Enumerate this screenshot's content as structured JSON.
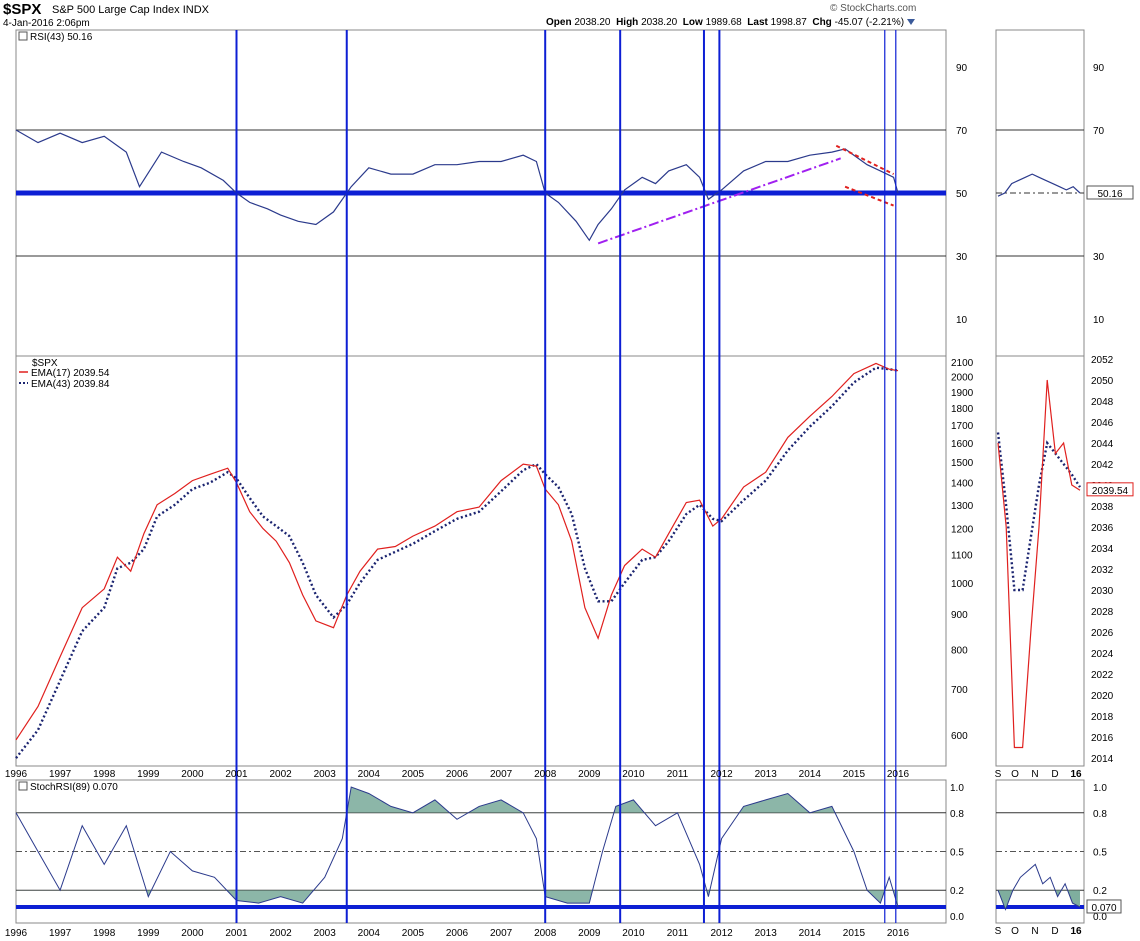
{
  "header": {
    "symbol": "$SPX",
    "name": "S&P 500 Large Cap Index",
    "exchange": "INDX",
    "date": "4-Jan-2016 2:06pm",
    "credit": "© StockCharts.com",
    "open_label": "Open",
    "open": "2038.20",
    "high_label": "High",
    "high": "2038.20",
    "low_label": "Low",
    "low": "1989.68",
    "last_label": "Last",
    "last": "1998.87",
    "chg_label": "Chg",
    "chg": "-45.07 (-2.21%)"
  },
  "colors": {
    "price_line": "#2b3a8c",
    "ema17": "#e0201e",
    "ema43": "#1b2470",
    "vertical_lines": "#0d1fd4",
    "trend_purple": "#a020f0",
    "trend_red": "#e0201e",
    "stoch_fill": "#7fae9e"
  },
  "chart_data": [
    {
      "type": "line",
      "title": "RSI(43) 50.16",
      "legend": "RSI(43) 50.16",
      "yticks": [
        "90",
        "70",
        "50",
        "30",
        "10"
      ],
      "ylim": [
        0,
        100
      ],
      "x": [
        1996.0,
        1996.5,
        1997.0,
        1997.5,
        1998.0,
        1998.5,
        1998.8,
        1999.3,
        1999.8,
        2000.2,
        2000.7,
        2001.0,
        2001.3,
        2001.7,
        2002.0,
        2002.4,
        2002.8,
        2003.2,
        2003.6,
        2004.0,
        2004.5,
        2005.0,
        2005.5,
        2006.0,
        2006.5,
        2007.0,
        2007.5,
        2007.8,
        2008.0,
        2008.3,
        2008.7,
        2009.0,
        2009.2,
        2009.5,
        2009.8,
        2010.2,
        2010.5,
        2010.8,
        2011.2,
        2011.5,
        2011.7,
        2012.0,
        2012.5,
        2013.0,
        2013.5,
        2014.0,
        2014.5,
        2014.8,
        2015.0,
        2015.3,
        2015.6,
        2015.9,
        2016.0
      ],
      "values": [
        70,
        66,
        69,
        66,
        68,
        63,
        52,
        63,
        60,
        58,
        54,
        50,
        47,
        45,
        43,
        41,
        40,
        44,
        52,
        58,
        56,
        56,
        59,
        59,
        60,
        60,
        62,
        60,
        50,
        47,
        41,
        35,
        40,
        45,
        51,
        55,
        53,
        57,
        59,
        55,
        48,
        51,
        57,
        60,
        60,
        62,
        63,
        64,
        62,
        59,
        57,
        55,
        50
      ],
      "reference_lines": [
        70,
        50,
        30
      ],
      "trendlines": [
        {
          "color": "purple",
          "from": [
            2009.2,
            34
          ],
          "to": [
            2014.7,
            61
          ]
        },
        {
          "color": "red",
          "from": [
            2014.6,
            65
          ],
          "to": [
            2015.9,
            56
          ]
        },
        {
          "color": "red",
          "from": [
            2014.8,
            52
          ],
          "to": [
            2015.9,
            46
          ]
        }
      ],
      "inset": {
        "value_label": "50.16",
        "values": [
          49,
          50,
          53,
          54,
          55,
          56,
          55,
          54,
          53,
          52,
          51,
          52,
          50
        ]
      }
    },
    {
      "type": "line",
      "title": "$SPX",
      "legend": [
        "$SPX",
        "EMA(17) 2039.54",
        "EMA(43) 2039.84"
      ],
      "yscale": "log",
      "yticks": [
        "2100",
        "2000",
        "1900",
        "1800",
        "1700",
        "1600",
        "1500",
        "1400",
        "1300",
        "1200",
        "1100",
        "1000",
        "900",
        "800",
        "700",
        "600"
      ],
      "ylim": [
        540,
        2150
      ],
      "x": [
        1996.0,
        1996.5,
        1997.0,
        1997.5,
        1998.0,
        1998.3,
        1998.6,
        1998.9,
        1999.2,
        1999.6,
        2000.0,
        2000.4,
        2000.8,
        2001.0,
        2001.3,
        2001.6,
        2001.9,
        2002.2,
        2002.5,
        2002.8,
        2003.2,
        2003.5,
        2003.8,
        2004.2,
        2004.6,
        2005.0,
        2005.5,
        2006.0,
        2006.5,
        2007.0,
        2007.5,
        2007.8,
        2008.0,
        2008.3,
        2008.6,
        2008.9,
        2009.2,
        2009.5,
        2009.8,
        2010.2,
        2010.5,
        2010.8,
        2011.2,
        2011.5,
        2011.8,
        2012.0,
        2012.5,
        2013.0,
        2013.5,
        2014.0,
        2014.5,
        2015.0,
        2015.5,
        2015.8,
        2016.0
      ],
      "series": [
        {
          "name": "EMA(17) 2039.54",
          "values": [
            590,
            660,
            780,
            920,
            980,
            1090,
            1040,
            1180,
            1300,
            1350,
            1410,
            1440,
            1470,
            1400,
            1270,
            1200,
            1150,
            1070,
            960,
            880,
            860,
            960,
            1040,
            1120,
            1130,
            1170,
            1210,
            1270,
            1290,
            1410,
            1490,
            1480,
            1370,
            1300,
            1150,
            920,
            830,
            960,
            1060,
            1120,
            1090,
            1180,
            1310,
            1320,
            1210,
            1240,
            1380,
            1450,
            1630,
            1750,
            1870,
            2020,
            2090,
            2050,
            2040
          ]
        },
        {
          "name": "EMA(43) 2039.84",
          "values": [
            555,
            610,
            720,
            850,
            920,
            1050,
            1070,
            1120,
            1250,
            1300,
            1370,
            1400,
            1450,
            1420,
            1330,
            1250,
            1210,
            1170,
            1070,
            960,
            890,
            930,
            1000,
            1080,
            1110,
            1140,
            1190,
            1240,
            1270,
            1360,
            1460,
            1490,
            1440,
            1380,
            1260,
            1050,
            940,
            940,
            1000,
            1080,
            1090,
            1150,
            1260,
            1300,
            1240,
            1230,
            1320,
            1410,
            1560,
            1690,
            1810,
            1960,
            2060,
            2050,
            2040
          ]
        }
      ],
      "inset": {
        "yticks": [
          "2052",
          "2050",
          "2048",
          "2046",
          "2044",
          "2042",
          "2040",
          "2038",
          "2036",
          "2034",
          "2032",
          "2030",
          "2028",
          "2026",
          "2024",
          "2022",
          "2020",
          "2018",
          "2016",
          "2014"
        ],
        "ylim": [
          2013,
          2053
        ],
        "value_label": "2039.54",
        "ema17": [
          2044,
          2036,
          2015,
          2015,
          2026,
          2036,
          2050,
          2043,
          2044,
          2040,
          2039.5
        ],
        "ema43": [
          2045,
          2038,
          2030,
          2030,
          2035,
          2040,
          2044,
          2043,
          2042,
          2041,
          2039.8
        ]
      }
    },
    {
      "type": "line",
      "title": "StochRSI(89) 0.070",
      "legend": "StochRSI(89) 0.070",
      "yticks": [
        "1.0",
        "0.8",
        "0.5",
        "0.2",
        "0.0"
      ],
      "ylim": [
        0,
        1
      ],
      "x": [
        1996.0,
        1996.5,
        1997.0,
        1997.5,
        1998.0,
        1998.5,
        1999.0,
        1999.5,
        2000.0,
        2000.5,
        2001.0,
        2001.5,
        2002.0,
        2002.5,
        2003.0,
        2003.4,
        2003.6,
        2004.0,
        2004.5,
        2005.0,
        2005.5,
        2006.0,
        2006.5,
        2007.0,
        2007.5,
        2007.8,
        2008.0,
        2008.5,
        2009.0,
        2009.3,
        2009.6,
        2010.0,
        2010.5,
        2011.0,
        2011.5,
        2011.7,
        2012.0,
        2012.5,
        2013.0,
        2013.5,
        2014.0,
        2014.5,
        2015.0,
        2015.3,
        2015.6,
        2015.8,
        2016.0
      ],
      "values": [
        0.8,
        0.5,
        0.2,
        0.7,
        0.4,
        0.7,
        0.15,
        0.5,
        0.35,
        0.3,
        0.12,
        0.1,
        0.15,
        0.1,
        0.3,
        0.6,
        1.0,
        0.95,
        0.85,
        0.8,
        0.9,
        0.75,
        0.85,
        0.9,
        0.8,
        0.6,
        0.15,
        0.1,
        0.1,
        0.5,
        0.85,
        0.9,
        0.7,
        0.8,
        0.4,
        0.15,
        0.6,
        0.85,
        0.9,
        0.95,
        0.8,
        0.85,
        0.5,
        0.2,
        0.1,
        0.3,
        0.07
      ],
      "reference_lines": [
        0.8,
        0.2
      ],
      "inset": {
        "value_label": "0.070",
        "values": [
          0.2,
          0.05,
          0.2,
          0.3,
          0.35,
          0.4,
          0.25,
          0.3,
          0.15,
          0.25,
          0.1,
          0.07
        ]
      }
    }
  ],
  "vertical_lines_x": [
    2001.0,
    2003.5,
    2008.0,
    2009.7,
    2011.6,
    2011.95,
    2015.7,
    2015.95
  ],
  "xaxis": {
    "year_labels": [
      "1996",
      "1997",
      "1998",
      "1999",
      "2000",
      "2001",
      "2002",
      "2003",
      "2004",
      "2005",
      "2006",
      "2007",
      "2008",
      "2009",
      "2010",
      "2011",
      "2012",
      "2013",
      "2014",
      "2015",
      "2016"
    ],
    "inset_labels": [
      "S",
      "O",
      "N",
      "D",
      "16"
    ]
  }
}
